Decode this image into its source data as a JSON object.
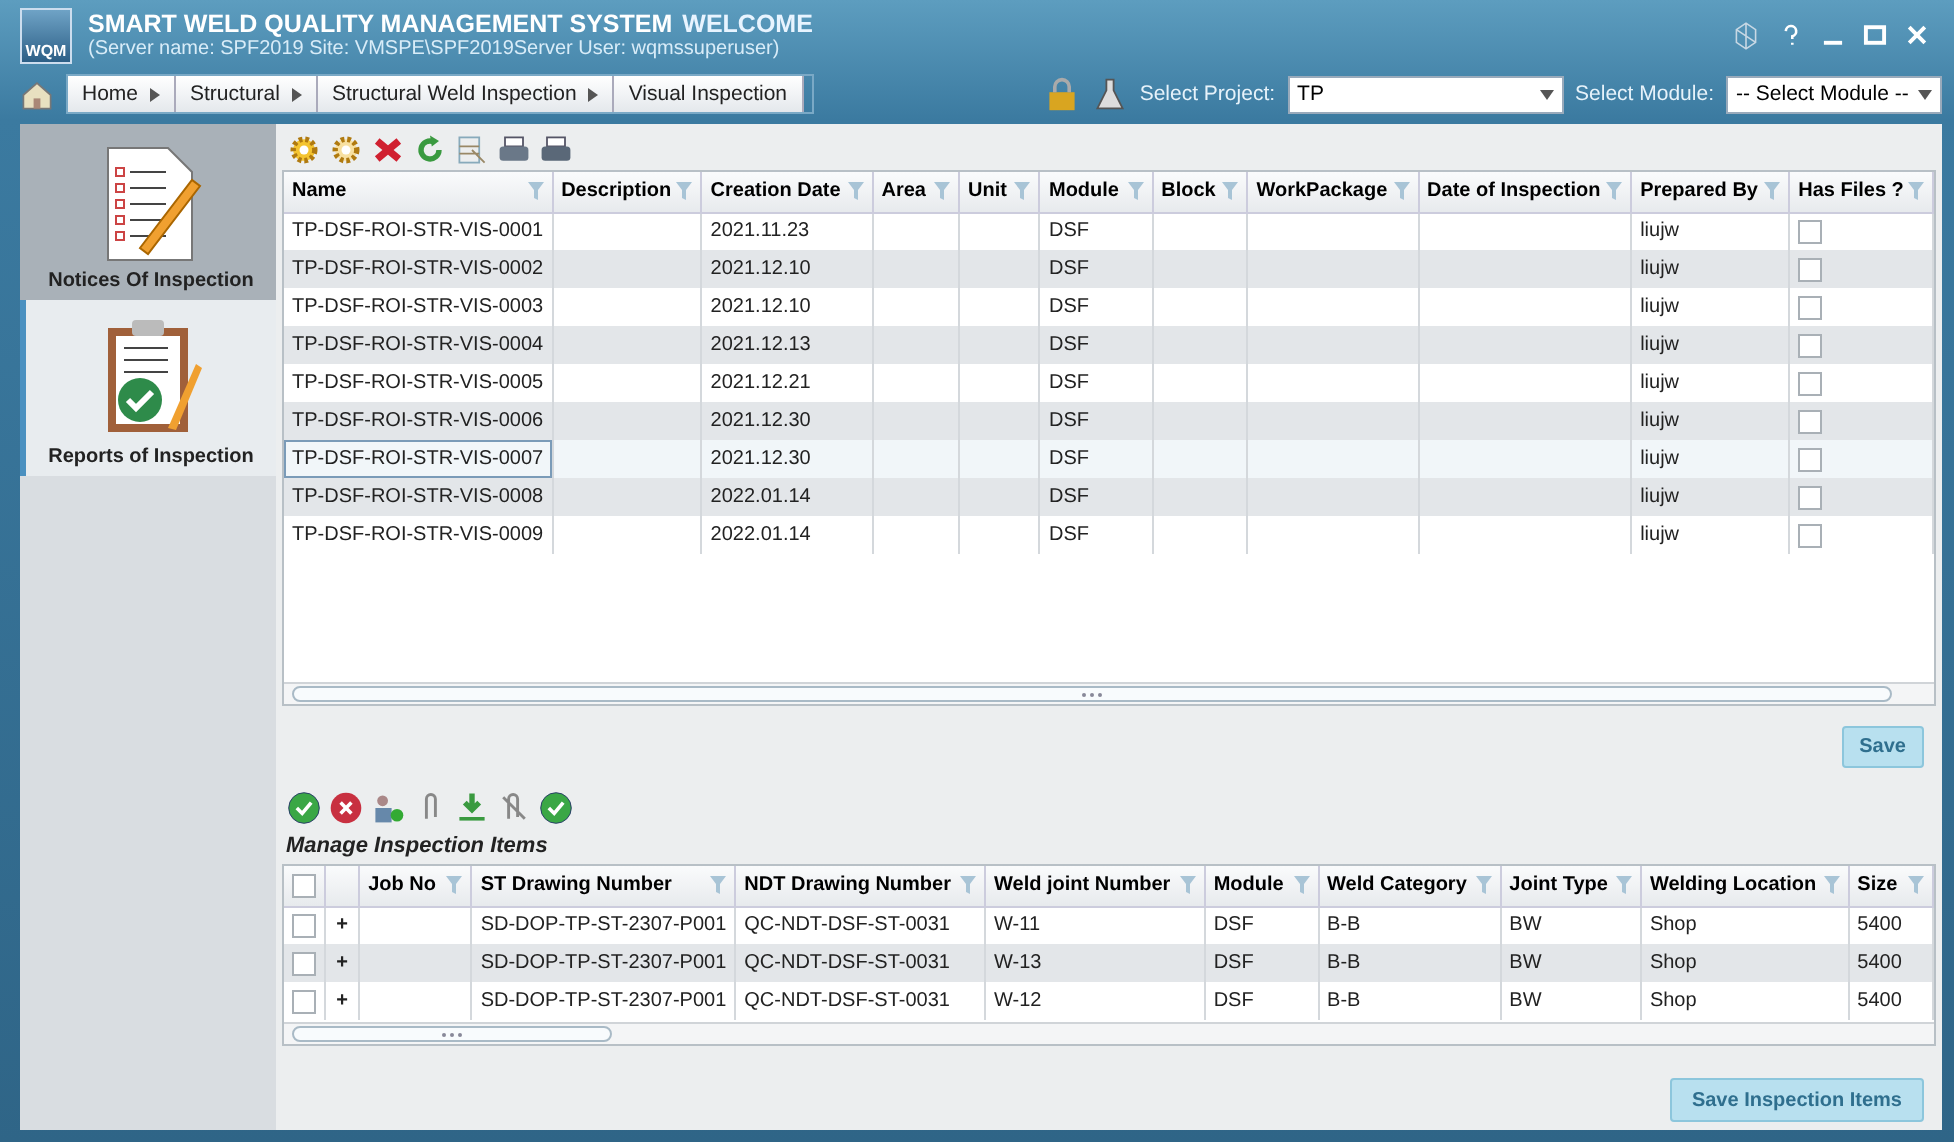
{
  "window": {
    "logo": "WQM",
    "title": "SMART WELD QUALITY MANAGEMENT SYSTEM",
    "welcome": "WELCOME",
    "subtitle": "(Server name: SPF2019 Site: VMSPE\\SPF2019Server User: wqmssuperuser)"
  },
  "breadcrumb": [
    "Home",
    "Structural",
    "Structural Weld Inspection",
    "Visual Inspection"
  ],
  "project": {
    "label": "Select Project:",
    "value": "TP"
  },
  "module": {
    "label": "Select Module:",
    "value": "-- Select Module --"
  },
  "sidebar": {
    "items": [
      {
        "label": "Notices Of Inspection",
        "kind": "notice",
        "selected": false
      },
      {
        "label": "Reports of Inspection",
        "kind": "report",
        "selected": true
      }
    ]
  },
  "reports_table": {
    "columns": [
      "Name",
      "Description",
      "Creation Date",
      "Area",
      "Unit",
      "Module",
      "Block",
      "WorkPackage",
      "Date of Inspection",
      "Prepared By",
      "Has Files ?"
    ],
    "rows": [
      {
        "name": "TP-DSF-ROI-STR-VIS-0001",
        "creation_date": "2021.11.23",
        "module": "DSF",
        "prepared_by": "liujw",
        "has_files": false,
        "selected": false
      },
      {
        "name": "TP-DSF-ROI-STR-VIS-0002",
        "creation_date": "2021.12.10",
        "module": "DSF",
        "prepared_by": "liujw",
        "has_files": false,
        "selected": false
      },
      {
        "name": "TP-DSF-ROI-STR-VIS-0003",
        "creation_date": "2021.12.10",
        "module": "DSF",
        "prepared_by": "liujw",
        "has_files": false,
        "selected": false
      },
      {
        "name": "TP-DSF-ROI-STR-VIS-0004",
        "creation_date": "2021.12.13",
        "module": "DSF",
        "prepared_by": "liujw",
        "has_files": false,
        "selected": false
      },
      {
        "name": "TP-DSF-ROI-STR-VIS-0005",
        "creation_date": "2021.12.21",
        "module": "DSF",
        "prepared_by": "liujw",
        "has_files": false,
        "selected": false
      },
      {
        "name": "TP-DSF-ROI-STR-VIS-0006",
        "creation_date": "2021.12.30",
        "module": "DSF",
        "prepared_by": "liujw",
        "has_files": false,
        "selected": false
      },
      {
        "name": "TP-DSF-ROI-STR-VIS-0007",
        "creation_date": "2021.12.30",
        "module": "DSF",
        "prepared_by": "liujw",
        "has_files": false,
        "selected": true
      },
      {
        "name": "TP-DSF-ROI-STR-VIS-0008",
        "creation_date": "2022.01.14",
        "module": "DSF",
        "prepared_by": "liujw",
        "has_files": false,
        "selected": false
      },
      {
        "name": "TP-DSF-ROI-STR-VIS-0009",
        "creation_date": "2022.01.14",
        "module": "DSF",
        "prepared_by": "liujw",
        "has_files": false,
        "selected": false
      }
    ]
  },
  "save_button": {
    "label": "Save",
    "disabled": true
  },
  "items_section": {
    "title": "Manage Inspection Items"
  },
  "items_table": {
    "select_all": {
      "checked": false
    },
    "columns": [
      "Job No",
      "ST Drawing Number",
      "NDT Drawing Number",
      "Weld joint Number",
      "Module",
      "Weld Category",
      "Joint Type",
      "Welding Location",
      "Size"
    ],
    "rows": [
      {
        "checked": false,
        "expander": "+",
        "st_drawing_number": "SD-DOP-TP-ST-2307-P001",
        "ndt_drawing_number": "QC-NDT-DSF-ST-0031",
        "weld_joint_number": "W-11",
        "module": "DSF",
        "weld_category": "B-B",
        "joint_type": "BW",
        "welding_location": "Shop",
        "size": "5400"
      },
      {
        "checked": false,
        "expander": "+",
        "st_drawing_number": "SD-DOP-TP-ST-2307-P001",
        "ndt_drawing_number": "QC-NDT-DSF-ST-0031",
        "weld_joint_number": "W-13",
        "module": "DSF",
        "weld_category": "B-B",
        "joint_type": "BW",
        "welding_location": "Shop",
        "size": "5400"
      },
      {
        "checked": false,
        "expander": "+",
        "st_drawing_number": "SD-DOP-TP-ST-2307-P001",
        "ndt_drawing_number": "QC-NDT-DSF-ST-0031",
        "weld_joint_number": "W-12",
        "module": "DSF",
        "weld_category": "B-B",
        "joint_type": "BW",
        "welding_location": "Shop",
        "size": "5400"
      }
    ]
  },
  "save_items_button": {
    "label": "Save Inspection Items",
    "disabled": true
  }
}
